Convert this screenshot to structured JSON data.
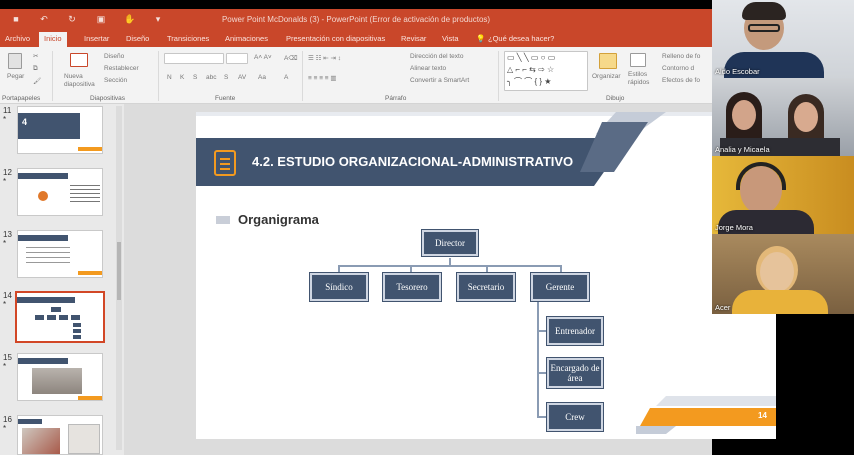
{
  "window": {
    "title": "Power Point McDonalds (3) - PowerPoint (Error de activación de productos)"
  },
  "tabs": [
    "Archivo",
    "Inicio",
    "Insertar",
    "Diseño",
    "Transiciones",
    "Animaciones",
    "Presentación con diapositivas",
    "Revisar",
    "Vista"
  ],
  "tell_me": "¿Qué desea hacer?",
  "ribbon": {
    "paste": "Pegar",
    "new_slide": "Nueva diapositiva",
    "layout": "Diseño",
    "reset": "Restablecer",
    "section": "Sección",
    "text_direction": "Dirección del texto",
    "align_text": "Alinear texto",
    "smartart": "Convertir a SmartArt",
    "arrange": "Organizar",
    "quick_styles": "Estilos rápidos",
    "shape_fill": "Relleno de fo",
    "shape_outline": "Contorno d",
    "shape_effects": "Efectos de fo",
    "groups": {
      "clipboard": "Portapapeles",
      "slides": "Diapositivas",
      "font": "Fuente",
      "paragraph": "Párrafo",
      "drawing": "Dibujo"
    },
    "font_buttons": [
      "N",
      "K",
      "S",
      "abc",
      "S",
      "AV",
      "Aa",
      "A"
    ]
  },
  "thumbnails": [
    {
      "num": "11",
      "star": "*"
    },
    {
      "num": "12",
      "star": "*"
    },
    {
      "num": "13",
      "star": "*"
    },
    {
      "num": "14",
      "star": "*"
    },
    {
      "num": "15",
      "star": "*"
    },
    {
      "num": "16",
      "star": "*"
    }
  ],
  "slide": {
    "title": "4.2. ESTUDIO ORGANIZACIONAL-ADMINISTRATIVO",
    "subtitle": "Organigrama",
    "page_number": "14",
    "org": {
      "top": "Director",
      "row": [
        "Síndico",
        "Tesorero",
        "Secretario",
        "Gerente"
      ],
      "sub": [
        "Entrenador",
        "Encargado de área",
        "Crew"
      ]
    }
  },
  "participants": [
    {
      "name": "Aldo Escobar"
    },
    {
      "name": "Analia y Micaela"
    },
    {
      "name": "Jorge Mora"
    },
    {
      "name": "Acer"
    }
  ],
  "colors": {
    "accent": "#c9472a",
    "slide_dark": "#41546f",
    "slide_orange": "#f39a1f"
  }
}
